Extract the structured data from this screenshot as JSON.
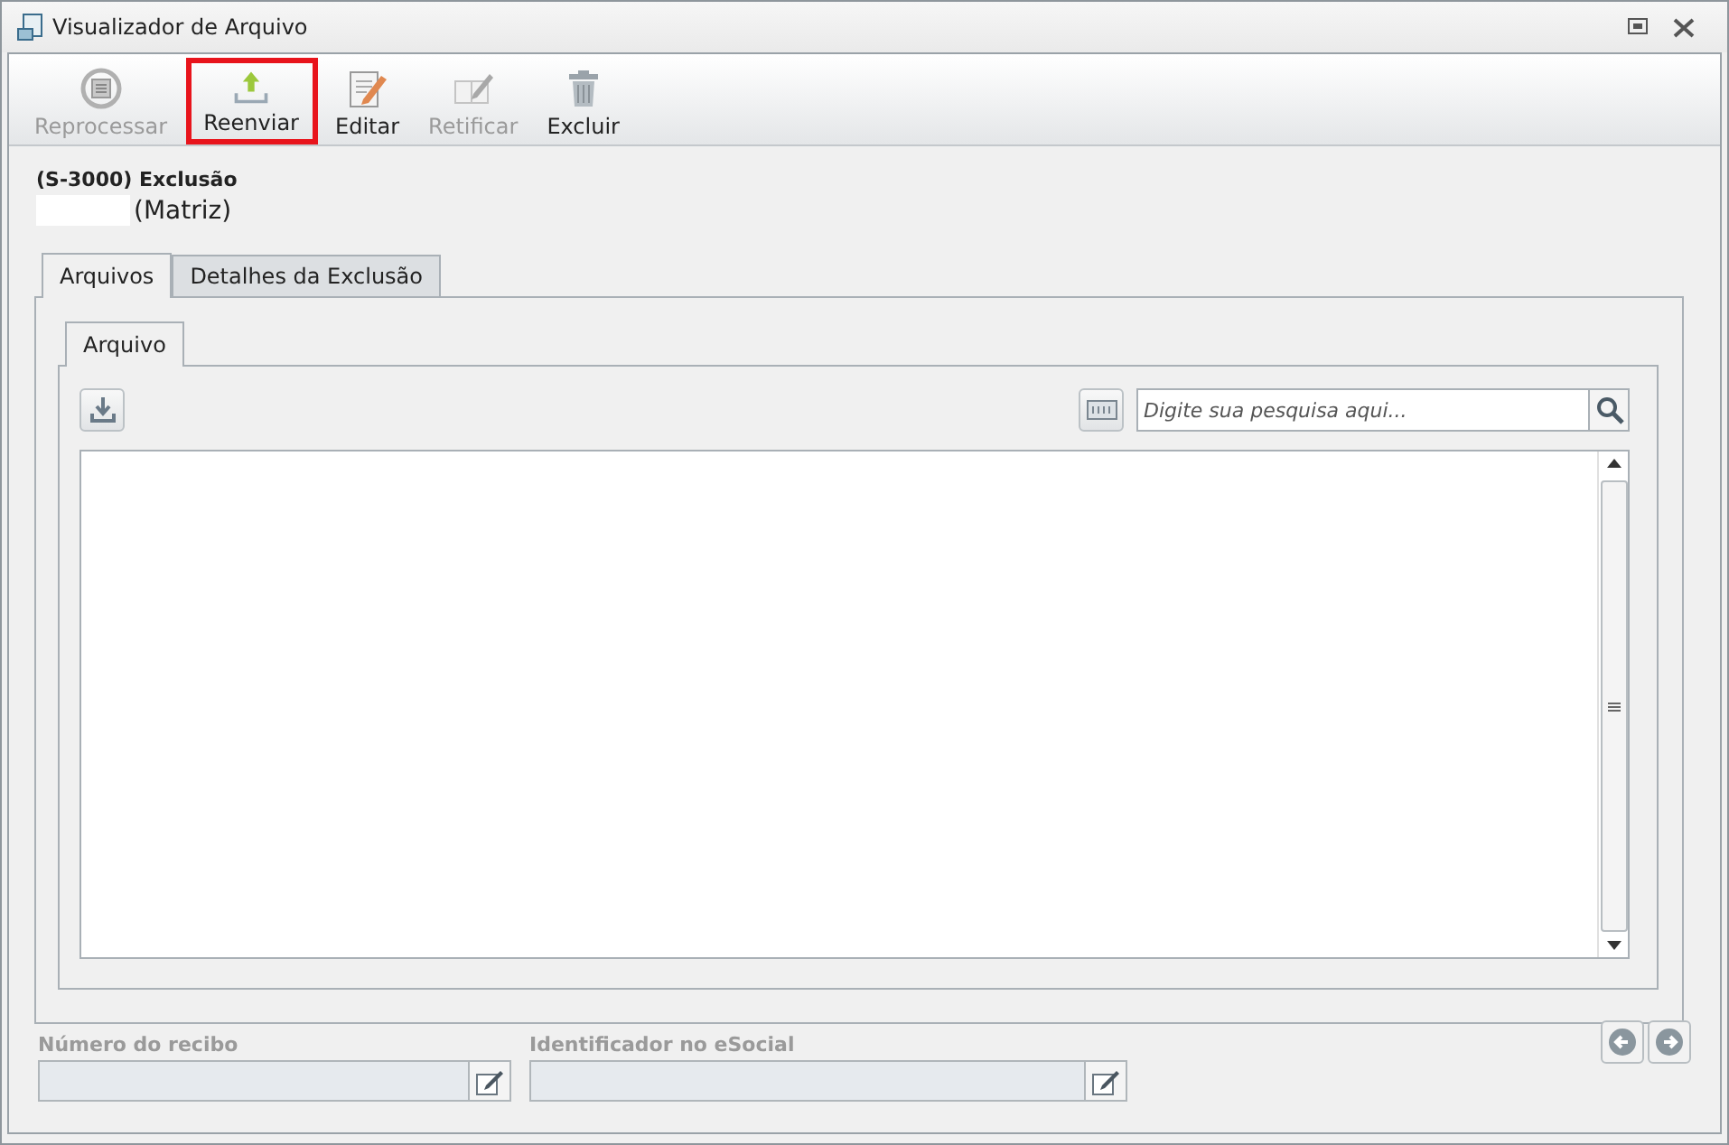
{
  "window": {
    "title": "Visualizador de Arquivo"
  },
  "toolbar": [
    {
      "label": "Reprocessar",
      "kind": "reprocess",
      "disabled": true,
      "highlighted": false
    },
    {
      "label": "Reenviar",
      "kind": "upload",
      "disabled": false,
      "highlighted": true
    },
    {
      "label": "Editar",
      "kind": "edit",
      "disabled": false,
      "highlighted": false
    },
    {
      "label": "Retificar",
      "kind": "rectify",
      "disabled": true,
      "highlighted": false
    },
    {
      "label": "Excluir",
      "kind": "delete",
      "disabled": false,
      "highlighted": false
    }
  ],
  "header": {
    "title": "(S-3000) Exclusão",
    "subtitle": "(Matriz)",
    "redacted": true
  },
  "tabs": [
    {
      "label": "Arquivos",
      "selected": true
    },
    {
      "label": "Detalhes da Exclusão",
      "selected": false
    }
  ],
  "inner_tabs": [
    {
      "label": "Arquivo",
      "selected": true
    }
  ],
  "search": {
    "placeholder": "Digite sua pesquisa aqui..."
  },
  "fields": [
    {
      "label": "Número do recibo",
      "disabled": true
    },
    {
      "label": "Identificador no eSocial",
      "disabled": true
    }
  ]
}
